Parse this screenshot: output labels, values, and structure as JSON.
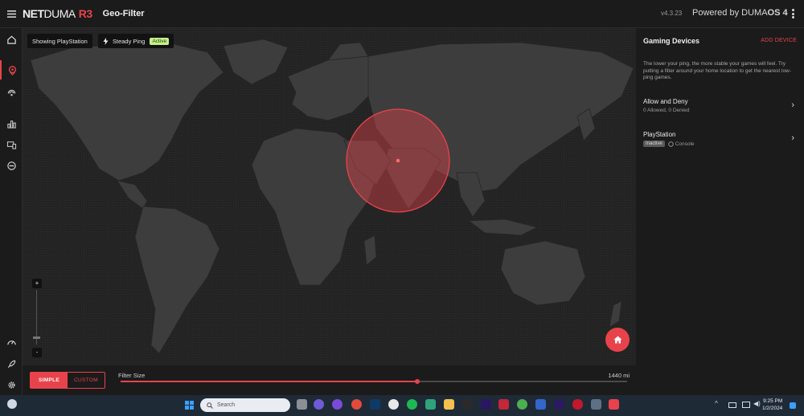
{
  "header": {
    "brand_net": "NET",
    "brand_duma": "DUMA",
    "brand_model": "R3",
    "page_title": "Geo-Filter",
    "version": "v4.3.23",
    "powered_prefix": "Powered by ",
    "powered_duma": "DUMA",
    "powered_os": "OS 4"
  },
  "nav": {
    "items": [
      "home-icon",
      "geo-filter-icon",
      "ping-heatmap-icon",
      "statistics-icon",
      "devices-icon",
      "block-icon",
      "speedometer-icon",
      "rocket-icon",
      "settings-icon"
    ],
    "active": "geo-filter-icon"
  },
  "map": {
    "showing_chip": "Showing PlayStation",
    "steady_ping_label": "Steady Ping",
    "steady_ping_status": "Active",
    "zoom_in": "+",
    "zoom_out": "-",
    "zoom_level": 0.1
  },
  "panel": {
    "title": "Gaming Devices",
    "add_device": "ADD DEVICE",
    "description": "The lower your ping, the more stable your games will feel. Try putting a filter around your home location to get the nearest low-ping games.",
    "devices": [
      {
        "name": "Allow and Deny",
        "sub": "0 Allowed, 0 Denied"
      },
      {
        "name": "PlayStation",
        "status": "Inactive",
        "type": "Console"
      }
    ]
  },
  "bottom": {
    "simple": "SIMPLE",
    "custom": "CUSTOM",
    "filter_label": "Filter Size",
    "filter_value": "1440 mi",
    "filter_fraction": 0.585
  },
  "taskbar": {
    "search_placeholder": "Search",
    "time": "9:25 PM",
    "date": "1/2/2024"
  },
  "colors": {
    "accent": "#e8434b",
    "active_badge": "#c6f08a"
  }
}
